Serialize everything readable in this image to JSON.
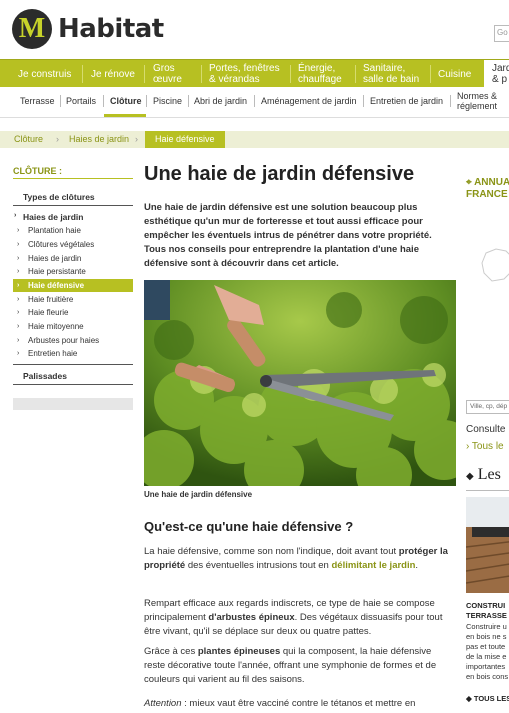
{
  "header": {
    "logo_letter": "M",
    "logo_text": "Habitat",
    "search_placeholder": "Go"
  },
  "main_nav": [
    "Je construis",
    "Je rénove",
    "Gros œuvre",
    "Portes, fenêtres & vérandas",
    "Énergie, chauffage",
    "Sanitaire, salle de bain",
    "Cuisine",
    "Jardin & p"
  ],
  "sub_nav": [
    "Terrasse",
    "Portails",
    "Clôture",
    "Piscine",
    "Abri de jardin",
    "Aménagement de jardin",
    "Entretien de jardin",
    "Normes & réglement"
  ],
  "breadcrumb": {
    "items": [
      "Clôture",
      "Haies de jardin",
      "Haie défensive"
    ]
  },
  "sidebar": {
    "title": "CLÔTURE :",
    "sections": [
      "Types de clôtures",
      "Haies de jardin",
      "Palissades"
    ],
    "haies_items": [
      "Plantation haie",
      "Clôtures végétales",
      "Haies de jardin",
      "Haie persistante",
      "Haie défensive",
      "Haie fruitière",
      "Haie fleurie",
      "Haie mitoyenne",
      "Arbustes pour haies",
      "Entretien haie"
    ],
    "active_item": "Haie défensive"
  },
  "article": {
    "title": "Une haie de jardin défensive",
    "intro": "Une haie de jardin défensive est une solution beaucoup plus esthétique qu'un mur de forteresse et tout aussi efficace pour empêcher les éventuels intrus de pénétrer dans votre propriété. Tous nos conseils pour entreprendre la plantation d'une haie défensive sont à découvrir dans cet article.",
    "image_caption": "Une haie de jardin défensive",
    "section_heading": "Qu'est-ce qu'une haie défensive ?",
    "p1": {
      "a": "La haie défensive, comme son nom l'indique, doit avant tout ",
      "b": "protéger la propriété",
      "c": " des éventuelles intrusions tout en ",
      "d": "délimitant le jardin",
      "e": "."
    },
    "p2": {
      "a": "Rempart efficace aux regards indiscrets, ce type de haie se compose principalement ",
      "b": "d'arbustes épineux",
      "c": ". Des végétaux dissuasifs pour tout être vivant, qu'il se déplace sur deux ou quatre pattes."
    },
    "p3": {
      "a": "Grâce à ces ",
      "b": "plantes épineuses",
      "c": " qui la composent, la haie défensive reste décorative toute l'année, offrant une symphonie de formes et de couleurs qui varient au fil des saisons."
    },
    "p4": {
      "a": "Attention",
      "b": " : mieux vaut être vacciné contre le tétanos et mettre en"
    }
  },
  "right": {
    "annuaire": "ANNUA",
    "france": "FRANCE",
    "city_placeholder": "Ville, cp, dép",
    "consulter": "Consulte",
    "tous": "› Tous le",
    "les": "Les",
    "promo_title": "CONSTRUI\nTERRASSE",
    "promo_text": "Construire u\nen bois ne s\npas et toute\nde la mise e\nimportantes\nen bois cons",
    "tous_les": "TOUS LES"
  },
  "colors": {
    "brand_green": "#b7c022",
    "dark_green": "#8a9416",
    "breadcrumb_bg": "#edefd5"
  }
}
